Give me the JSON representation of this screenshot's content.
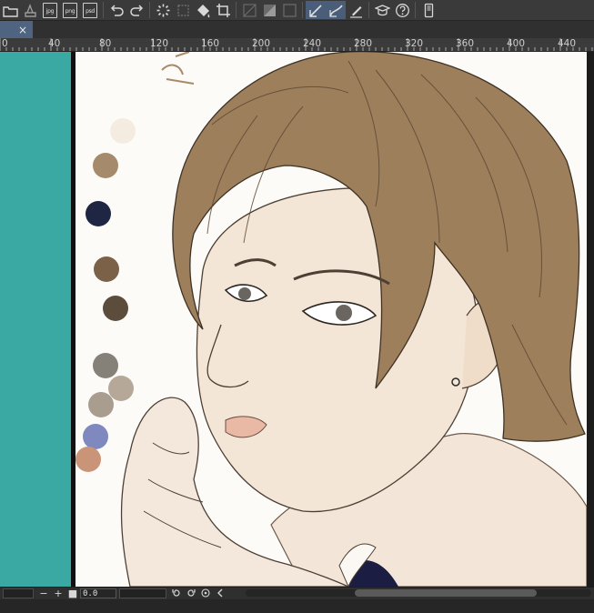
{
  "toolbar": {
    "file_export_labels": [
      "jpg",
      "png",
      "psd"
    ],
    "icons": [
      "open-folder-icon",
      "save-icon",
      "export-jpg-icon",
      "export-png-icon",
      "export-psd-icon",
      "undo-icon",
      "redo-icon",
      "loading-icon",
      "transform-icon",
      "fill-icon",
      "crop-icon",
      "ruler-toggle-icon",
      "snap-toggle-icon",
      "grid-toggle-icon",
      "pen-stroke-icon",
      "curve-stroke-icon",
      "edit-icon",
      "learn-icon",
      "help-icon",
      "device-icon"
    ]
  },
  "tab": {
    "close_label": "×"
  },
  "ruler": {
    "ticks": [
      "0",
      "40",
      "80",
      "120",
      "160",
      "200",
      "240",
      "280",
      "320",
      "360",
      "400",
      "440"
    ]
  },
  "palette": {
    "swatches": [
      "#f4ece0",
      "#a58b6c",
      "#1f2644",
      "#7a6148",
      "#5c4c3c",
      "#858078",
      "#b6a898",
      "#a99d90",
      "#8088c0",
      "#c99478"
    ]
  },
  "canvas": {
    "annotation_text": "ꝗ"
  },
  "statusbar": {
    "zoom_value": "0.0",
    "minus_label": "−",
    "plus_label": "+",
    "square_label": "■"
  },
  "colors": {
    "teal_panel": "#3aa9a3",
    "hair": "#9d7f5c",
    "skin": "#f3e6d8",
    "suit": "#1b1d42"
  }
}
